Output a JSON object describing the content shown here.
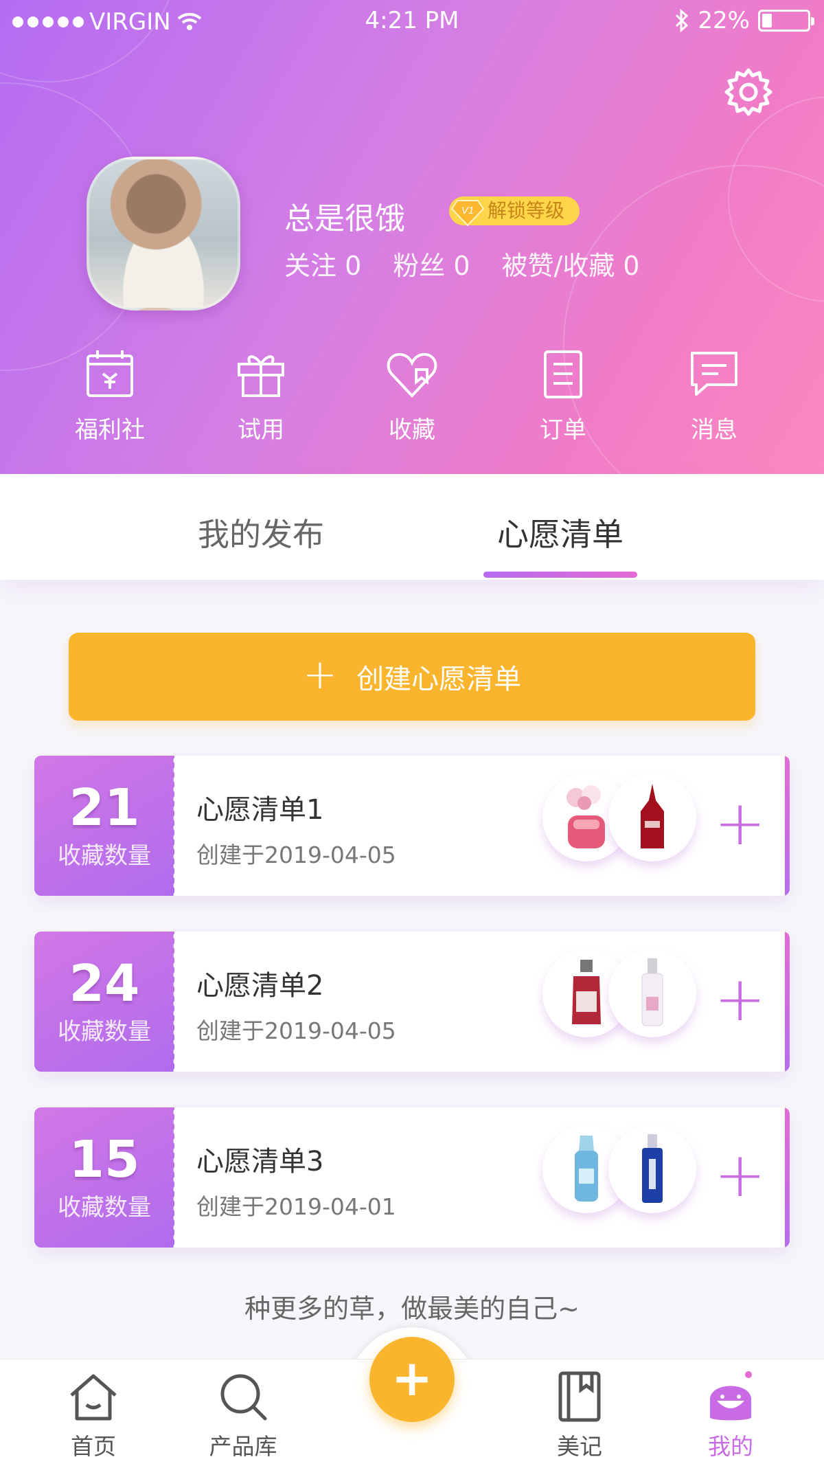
{
  "status_bar": {
    "carrier": "VIRGIN",
    "time": "4:21 PM",
    "battery": "22%"
  },
  "profile": {
    "username": "总是很饿",
    "level_badge": "解锁等级",
    "level_icon": "V1",
    "stats": {
      "following": "关注 0",
      "fans": "粉丝 0",
      "likes": "被赞/收藏 0"
    }
  },
  "quick_actions": [
    {
      "label": "福利社",
      "icon": "calendar-gift-icon"
    },
    {
      "label": "试用",
      "icon": "gift-box-icon"
    },
    {
      "label": "收藏",
      "icon": "heart-bookmark-icon"
    },
    {
      "label": "订单",
      "icon": "order-list-icon"
    },
    {
      "label": "消息",
      "icon": "message-icon"
    }
  ],
  "tabs": [
    {
      "label": "我的发布",
      "active": false
    },
    {
      "label": "心愿清单",
      "active": true
    }
  ],
  "create_button": {
    "label": "创建心愿清单"
  },
  "wishlists": [
    {
      "count": "21",
      "count_label": "收藏数量",
      "title": "心愿清单1",
      "date": "创建于2019-04-05"
    },
    {
      "count": "24",
      "count_label": "收藏数量",
      "title": "心愿清单2",
      "date": "创建于2019-04-05"
    },
    {
      "count": "15",
      "count_label": "收藏数量",
      "title": "心愿清单3",
      "date": "创建于2019-04-01"
    }
  ],
  "slogan": "种更多的草，做最美的自己~",
  "bottom_nav": [
    {
      "label": "首页",
      "icon": "home-icon",
      "active": false
    },
    {
      "label": "产品库",
      "icon": "search-icon",
      "active": false
    },
    {
      "label": "美记",
      "icon": "notebook-icon",
      "active": false
    },
    {
      "label": "我的",
      "icon": "profile-face-icon",
      "active": true
    }
  ],
  "colors": {
    "accent": "#c96be4",
    "orange": "#fbb42e",
    "gradient_start": "#b56cf2",
    "gradient_end": "#fb88c0"
  }
}
